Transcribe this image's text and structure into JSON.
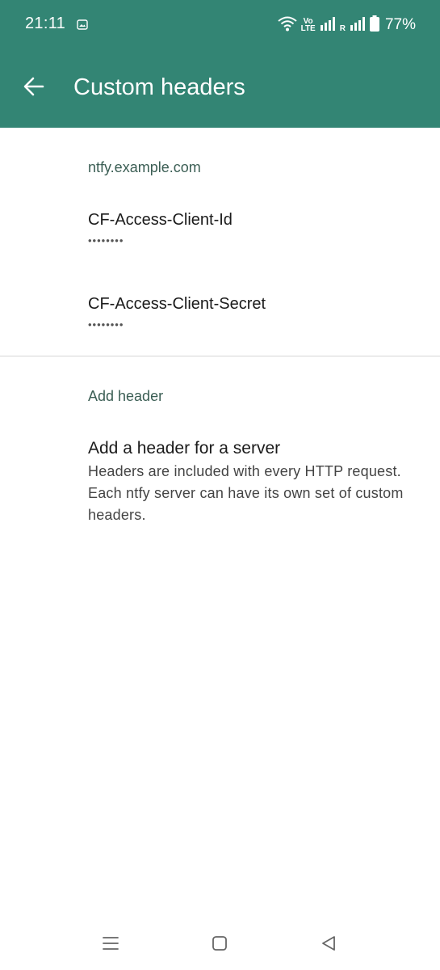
{
  "status_bar": {
    "time": "21:11",
    "volte_top": "Vo",
    "volte_bottom": "LTE",
    "roaming": "R",
    "battery": "77%"
  },
  "app_bar": {
    "title": "Custom headers",
    "back_icon": "arrow-left-icon",
    "background": "#338574"
  },
  "server_section": {
    "title": "ntfy.example.com",
    "headers": [
      {
        "name": "CF-Access-Client-Id",
        "value": "••••••••"
      },
      {
        "name": "CF-Access-Client-Secret",
        "value": "••••••••"
      }
    ]
  },
  "add_section": {
    "title": "Add header",
    "item_title": "Add a header for a server",
    "item_summary": "Headers are included with every HTTP request. Each ntfy server can have its own set of custom headers."
  },
  "nav_bar": {
    "icons": [
      "menu-icon",
      "home-icon",
      "back-triangle-icon"
    ]
  },
  "colors": {
    "accent": "#338574",
    "section_title": "#3b5e54"
  }
}
